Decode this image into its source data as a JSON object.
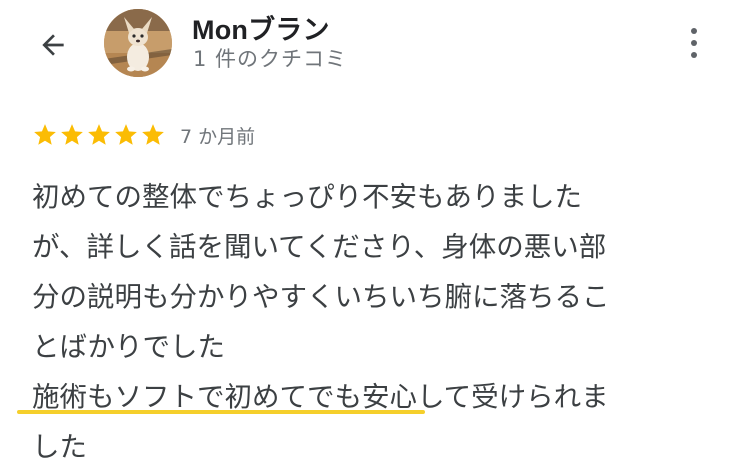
{
  "header": {
    "back_icon": "arrow-back-icon",
    "user_name": "Monブラン",
    "review_count": "1 件のクチコミ",
    "menu_icon": "more-vert-icon"
  },
  "review": {
    "rating": 5,
    "rating_max": 5,
    "star_color": "#fbbc04",
    "date": "7 か月前",
    "lines": [
      "初めての整体でちょっぴり不安もありました",
      "が、詳しく話を聞いてくださり、身体の悪い部",
      "分の説明も分かりやすくいちいち腑に落ちるこ",
      "とばかりでした"
    ],
    "highlighted_text": "施術もソフトで初めてでも安心",
    "highlight_rest": "して受けられま",
    "last_line": "した",
    "highlight_color": "#f5cf2b"
  }
}
